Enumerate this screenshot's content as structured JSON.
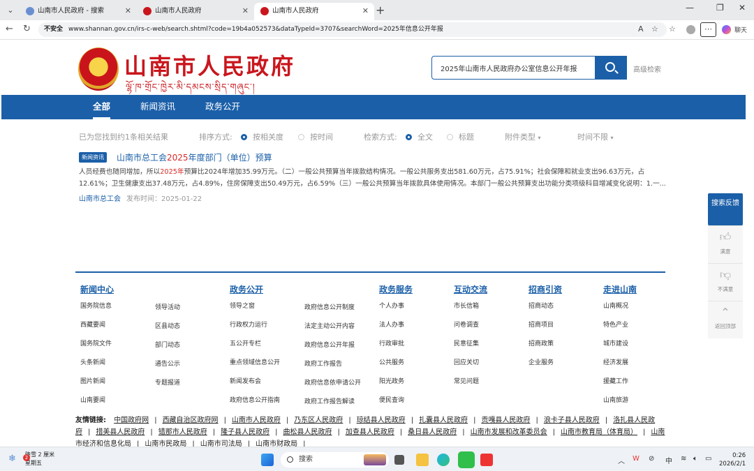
{
  "browser": {
    "tabs": [
      {
        "label": "山南市人民政府 - 搜索"
      },
      {
        "label": "山南市人民政府"
      },
      {
        "label": "山南市人民政府"
      }
    ],
    "url_prefix": "不安全",
    "url": "www.shannan.gov.cn/irs-c-web/search.shtml?code=19b4a052573&dataTypeId=3707&searchWord=2025年信息公开年报",
    "copilot_label": "聊天"
  },
  "site": {
    "title": "山南市人民政府",
    "subtitle": "ལྷོ་ཁ་གྲོང་ཁྱེར་མི་དམངས་སྲིད་གཞུང་།",
    "search_value": "2025年山南市人民政府办公室信息公开年报",
    "advanced": "高级检索"
  },
  "nav": [
    "全部",
    "新闻资讯",
    "政务公开"
  ],
  "filters": {
    "count_text": "已为您找到约1条相关结果",
    "sort_label": "排序方式:",
    "sort_relevance": "按相关度",
    "sort_time": "按时间",
    "search_label": "检索方式:",
    "mode_full": "全文",
    "mode_title": "标题",
    "attach": "附件类型",
    "time": "时间不限"
  },
  "result": {
    "badge": "新闻资讯",
    "title_pre": "山南市总工会",
    "title_hl": "2025",
    "title_post": "年度部门（单位）预算",
    "body_1": "人员经费也随同增加，所以",
    "body_hl1": "2025年",
    "body_2": "预算比2024年增加35.99万元。（二）一般公共预算当年拨款结构情况。一般公共服务支出581.60万元，占75.91%；社会保障和就业支出96.63万元，占12.61%；卫生健康支出37.48万元，占4.89%，住房保障支出50.49万元，占6.59%（三）一般公共预算当年拨款具体使用情况。本部门一般公共预算支出功能分类项级科目增减变化说明：1.一...",
    "source": "山南市总工会",
    "date": "发布时间：2025-01-22"
  },
  "footer_cols": [
    {
      "heading": "新闻中心",
      "items": [
        "国务院信息",
        "西藏要闻",
        "国务院文件",
        "头条新闻",
        "图片新闻",
        "山南要闻"
      ],
      "items2": [
        "领导活动",
        "区县动态",
        "部门动态",
        "通告公示",
        "专题报道"
      ]
    },
    {
      "heading": "政务公开",
      "items": [
        "领导之窗",
        "行政权力运行",
        "五公开专栏",
        "重点领域信息公开",
        "新闻发布会",
        "政府信息公开指南"
      ],
      "items2": [
        "政府信息公开制度",
        "法定主动公开内容",
        "政府信息公开年报",
        "政府工作报告",
        "政府信息依申请公开",
        "政府工作报告解读"
      ]
    },
    {
      "heading": "政务服务",
      "items": [
        "个人办事",
        "法人办事",
        "行政审批",
        "公共服务",
        "阳光政务",
        "便民查询"
      ]
    },
    {
      "heading": "互动交流",
      "items": [
        "市长信箱",
        "问卷调查",
        "民意征集",
        "回应关切",
        "常见问题"
      ]
    },
    {
      "heading": "招商引资",
      "items": [
        "招商动态",
        "招商项目",
        "招商政策",
        "企业服务"
      ]
    },
    {
      "heading": "走进山南",
      "items": [
        "山南概况",
        "特色产业",
        "城市建设",
        "经济发展",
        "援藏工作",
        "山南旅游"
      ]
    }
  ],
  "friend_links": {
    "label": "友情链接:",
    "links": [
      "中国政府网",
      "西藏自治区政府网",
      "山南市人民政府",
      "乃东区人民政府",
      "琼结县人民政府",
      "扎囊县人民政府",
      "贡嘎县人民政府",
      "浪卡子县人民政府",
      "洛扎县人民政府",
      "措美县人民政府",
      "错那市人民政府",
      "隆子县人民政府",
      "曲松县人民政府",
      "加查县人民政府",
      "桑日县人民政府",
      "山南市发展和改革委员会",
      "山南市教育局（体育局）",
      "山南市经济和信息化局",
      "山南市民政局",
      "山南市司法局",
      "山南市财政局"
    ]
  },
  "side": {
    "feedback": "搜索反馈",
    "like": "满意",
    "dislike": "不满意",
    "top": "返回顶部"
  },
  "taskbar": {
    "weather_line1": "降雪 2 厘米",
    "weather_line2": "星期五",
    "weather_badge": "2",
    "search": "搜索",
    "ime": "中",
    "time": "0:26",
    "date": "2026/2/1"
  }
}
